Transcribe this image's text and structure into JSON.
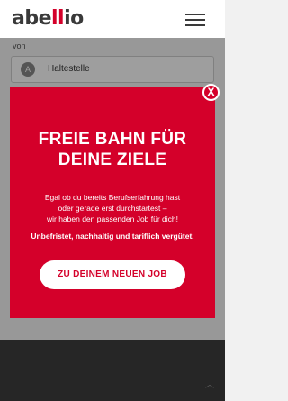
{
  "header": {
    "logo_prefix": "abe",
    "logo_mid": "ll",
    "logo_suffix": "io",
    "menu_icon": "hamburger-menu-icon"
  },
  "search": {
    "from_label": "von",
    "stop_badge": "A",
    "stop_placeholder": "Haltestelle"
  },
  "popup": {
    "headline_line1": "FREIE BAHN FÜR",
    "headline_line2": "DEINE ZIELE",
    "body_line1": "Egal ob du bereits Berufserfahrung hast",
    "body_line2": "oder gerade erst durchstartest –",
    "body_line3": "wir haben den passenden Job für dich!",
    "emphasis": "Unbefristet, nachhaltig und tariflich vergütet.",
    "cta_label": "ZU DEINEM NEUEN JOB",
    "close_label": "X"
  },
  "footer": {
    "scroll_top_icon": "chevron-up-icon"
  },
  "colors": {
    "brand_red": "#d4002a",
    "text_dark": "#3a3a3a",
    "footer_dark": "#3e3e3e"
  }
}
